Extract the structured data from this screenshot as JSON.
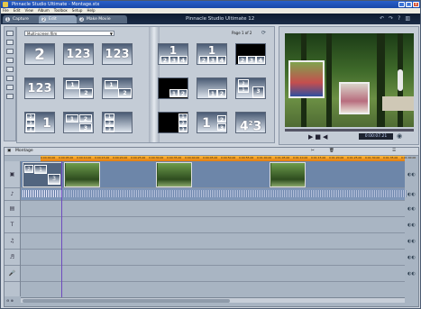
{
  "window": {
    "title": "Pinnacle Studio Ultimate - Montage.stx"
  },
  "menu": [
    "File",
    "Edit",
    "View",
    "Album",
    "Toolbox",
    "Setup",
    "Help"
  ],
  "tabs": [
    {
      "num": "1",
      "label": "Capture"
    },
    {
      "num": "2",
      "label": "Edit"
    },
    {
      "num": "3",
      "label": "Make Movie"
    }
  ],
  "app_title": "Pinnacle Studio Ultimate 12",
  "album": {
    "dropdown": "Multi-screen film",
    "page_indicator": "Page 1 of 2"
  },
  "preview": {
    "timecode": "0:00:07.21"
  },
  "timeline": {
    "label": "Montage",
    "ruler": [
      "0:00:00.00",
      "0:00:05.00",
      "0:00:10.00",
      "0:00:15.00",
      "0:00:20.00",
      "0:00:25.00",
      "0:00:30.00",
      "0:00:35.00",
      "0:00:40.00",
      "0:00:45.00",
      "0:00:50.00",
      "0:00:55.00",
      "0:01:00.00",
      "0:01:05.00",
      "0:01:10.00",
      "0:01:15.00",
      "0:01:20.00",
      "0:01:25.00",
      "0:01:30.00",
      "0:01:35.00",
      "0:01:40.00"
    ]
  }
}
